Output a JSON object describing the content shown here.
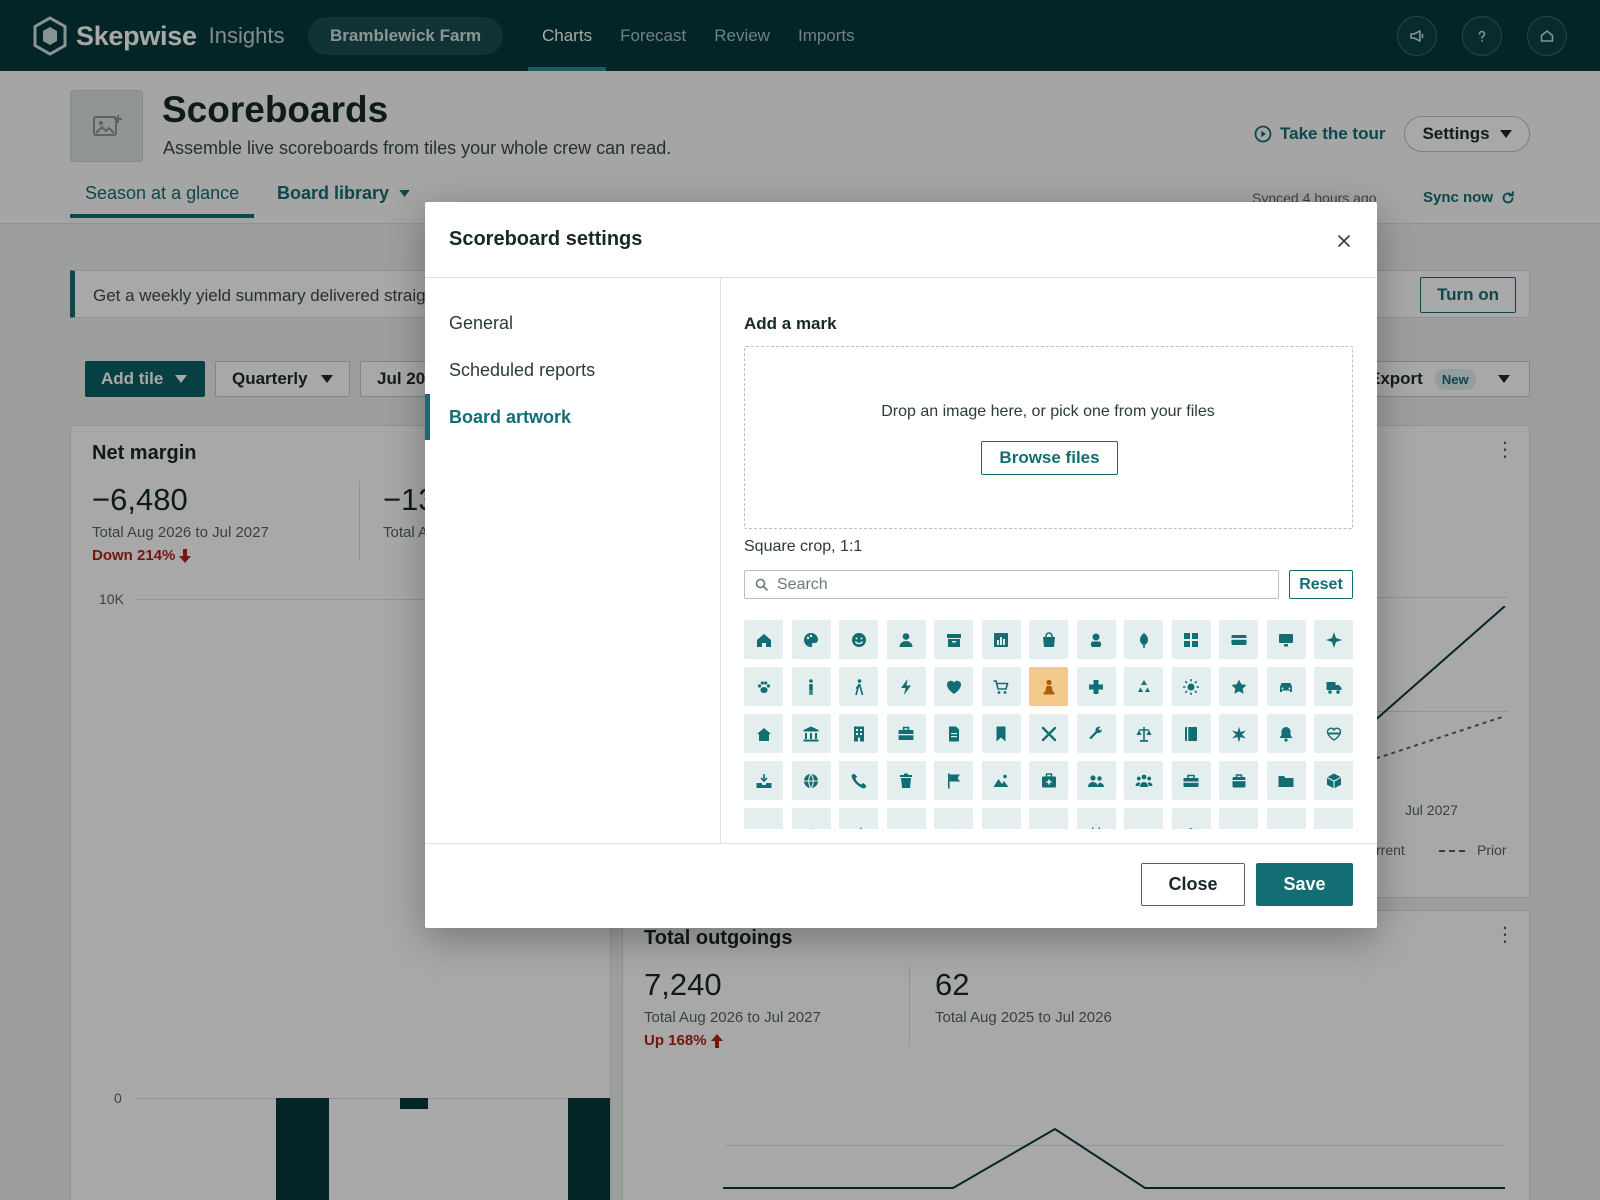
{
  "app": {
    "brand_name": "Skepwise",
    "brand_sub": "Insights",
    "farm": "Bramblewick Farm",
    "nav_tabs": [
      "Charts",
      "Forecast",
      "Review",
      "Imports"
    ],
    "active_tab": "Charts"
  },
  "header": {
    "title": "Scoreboards",
    "subtitle": "Assemble live scoreboards from tiles your whole crew can read.",
    "tour": "Take the tour",
    "settings": "Settings",
    "subtabs": [
      "Season at a glance",
      "Board library"
    ],
    "synced": "Synced 4 hours ago",
    "sync_now": "Sync now"
  },
  "banner": {
    "text": "Get a weekly yield summary delivered straig",
    "turn_on": "Turn on"
  },
  "toolbar": {
    "add_tile": "Add tile",
    "period": "Quarterly",
    "range": "Jul 20",
    "export": "Export",
    "export_badge": "New"
  },
  "cards": {
    "net_margin": {
      "title": "Net margin",
      "current_value": "−6,480",
      "current_caption": "Total Aug 2026 to Jul 2027",
      "delta": "Down 214%",
      "prior_value": "−13",
      "prior_caption": "Total A",
      "y_top": "10K",
      "y_zero": "0"
    },
    "second": {
      "x_label": "Jul 2027",
      "legend_current": "rrent",
      "legend_prior": "Prior"
    },
    "total_outgoings": {
      "title": "Total outgoings",
      "current_value": "7,240",
      "current_caption": "Total Aug 2026 to Jul 2027",
      "delta": "Up 168%",
      "prior_value": "62",
      "prior_caption": "Total Aug 2025 to Jul 2026"
    }
  },
  "modal": {
    "title": "Scoreboard settings",
    "sidebar": [
      "General",
      "Scheduled reports",
      "Board artwork"
    ],
    "active_section": "Board artwork",
    "pane_title": "Add a mark",
    "drop_text": "Drop an image here, or pick one from your files",
    "browse": "Browse files",
    "crop_note": "Square crop, 1:1",
    "search_placeholder": "Search",
    "reset": "Reset",
    "close": "Close",
    "save": "Save",
    "icons": [
      "home",
      "palette",
      "smiley",
      "person",
      "archive",
      "bar-chart",
      "shopping-bag",
      "user-badge",
      "leaf",
      "grid",
      "credit-card",
      "monitor",
      "sparkle",
      "paw",
      "person-standing",
      "person-walking",
      "bolt",
      "heart",
      "cart",
      "chess-pawn",
      "medical-cross",
      "recycle",
      "sun",
      "star",
      "car",
      "truck",
      "house",
      "bank",
      "office-building",
      "briefcase",
      "document",
      "bookmark",
      "tools",
      "wrench",
      "scales",
      "book",
      "starburst",
      "bell",
      "heart-outline",
      "inbox-tray",
      "globe",
      "phone",
      "trash",
      "flag",
      "landscape",
      "first-aid",
      "group",
      "team",
      "toolbox",
      "suitcase",
      "folder",
      "cube",
      "row5-a",
      "row5-b",
      "row5-c",
      "row5-d",
      "row5-e",
      "row5-f",
      "row5-g",
      "row5-h",
      "row5-i",
      "row5-j",
      "row5-k",
      "row5-l",
      "row5-m"
    ],
    "selected_icon": "chess-pawn"
  },
  "colors": {
    "nav_bg": "#06393e",
    "accent": "#136e73",
    "danger": "#b02419",
    "icon_tile_bg": "#e5eeee",
    "icon_selected_bg": "#f3c98b"
  }
}
